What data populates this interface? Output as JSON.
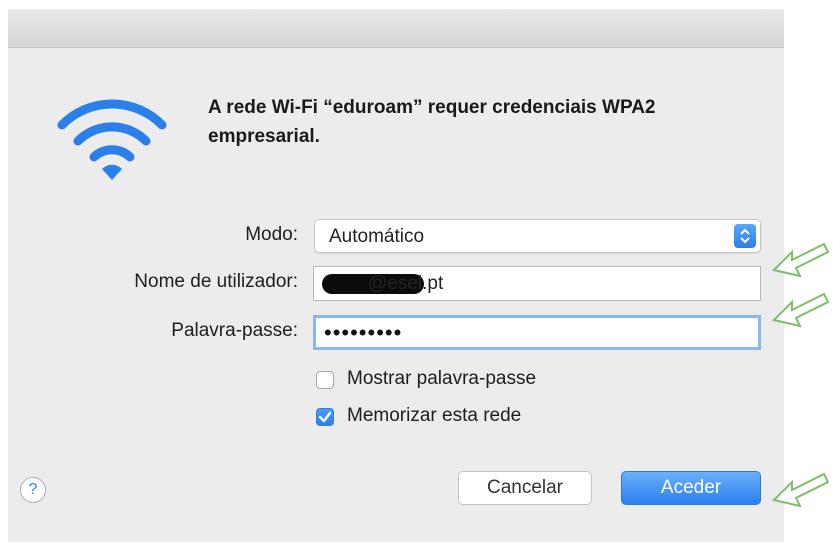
{
  "dialog": {
    "message": "A rede Wi-Fi “eduroam” requer credenciais WPA2 empresarial."
  },
  "form": {
    "mode_label": "Modo:",
    "mode_value": "Automático",
    "username_label": "Nome de utilizador:",
    "username_value": "@esel.pt",
    "password_label": "Palavra-passe:",
    "password_value": "•••••••••",
    "show_password_label": "Mostrar palavra-passe",
    "show_password_checked": false,
    "remember_label": "Memorizar esta rede",
    "remember_checked": true
  },
  "buttons": {
    "help": "?",
    "cancel": "Cancelar",
    "ok": "Aceder"
  },
  "colors": {
    "accent": "#2a7fe9",
    "annotation_arrow": "#7fbf6a"
  },
  "icons": [
    "wifi-icon",
    "popup-arrows-icon",
    "checkmark-icon",
    "help-icon",
    "annotation-arrow-icon"
  ]
}
